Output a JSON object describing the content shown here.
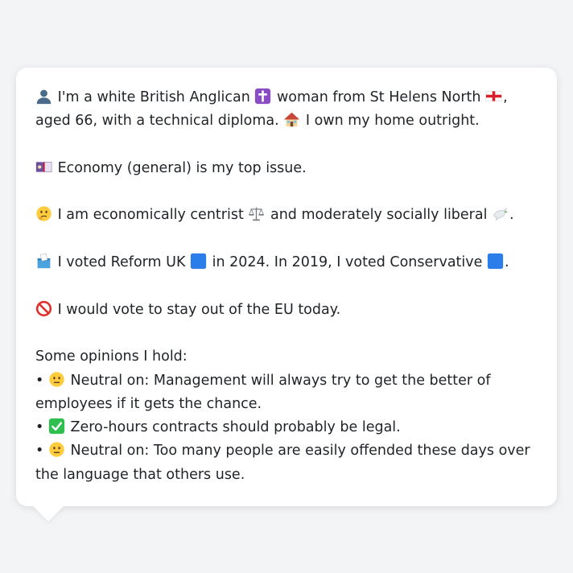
{
  "profile": {
    "line1": {
      "part1": "I'm a white British Anglican",
      "part2": "woman from St Helens North",
      "part3": ", aged 66, with a technical diploma.",
      "part4": "I own my home outright."
    },
    "line2": {
      "text": "Economy (general) is my top issue."
    },
    "line3": {
      "part1": "I am economically centrist",
      "part2": "and moderately socially liberal",
      "part3": "."
    },
    "line4": {
      "part1": "I voted Reform UK",
      "part2": "in 2024. In 2019, I voted Conservative",
      "part3": "."
    },
    "line5": {
      "text": "I would vote to stay out of the EU today."
    },
    "opinions": {
      "heading": "Some opinions I hold:",
      "bullet": "•",
      "items": [
        {
          "text": "Neutral on: Management will always try to get the better of employees if it gets the chance."
        },
        {
          "text": "Zero-hours contracts should probably be legal."
        },
        {
          "text": "Neutral on: Too many people are easily offended these days over the language that others use."
        }
      ]
    }
  },
  "colors": {
    "page_background": "#f3f4f6",
    "bubble_background": "#ffffff",
    "text": "#1f2328",
    "blue_square": "#2b7de9",
    "green_check": "#2fbf4f",
    "prohibited_red": "#e0322d"
  }
}
